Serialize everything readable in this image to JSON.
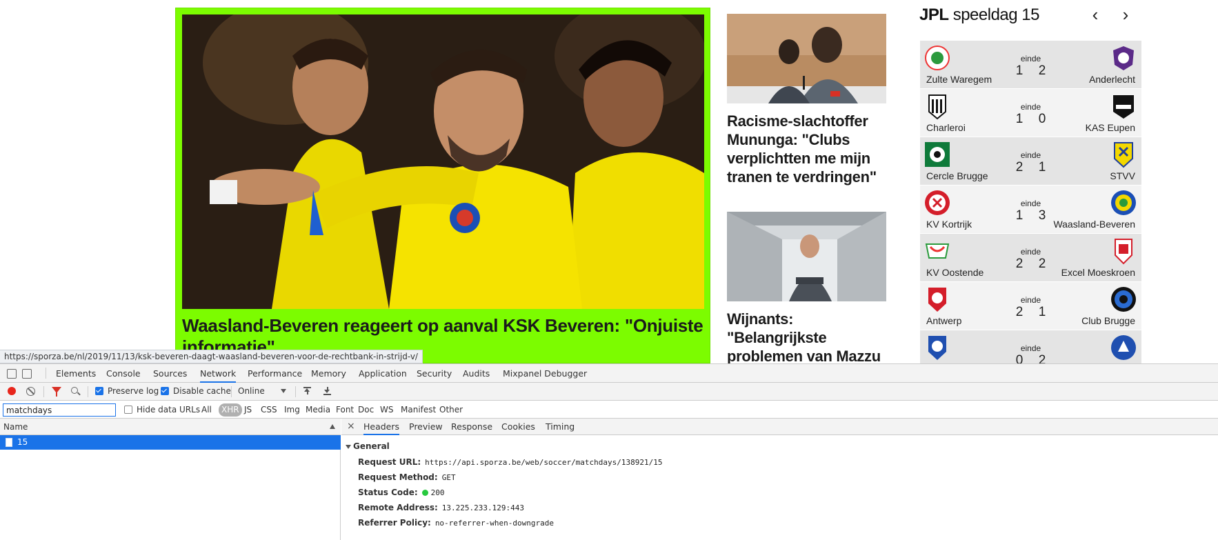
{
  "hero": {
    "title": "Waasland-Beveren reageert op aanval KSK Beveren: \"Onjuiste informatie\""
  },
  "articles": [
    {
      "title": "Racisme-slachtoffer Mununga: \"Clubs verplichtten me mijn tranen te verdringen\""
    },
    {
      "title": "Wijnants: \"Belangrijkste problemen van Mazzu"
    }
  ],
  "jpl": {
    "brand": "JPL",
    "matchday": "speeldag 15",
    "matches": [
      {
        "home": "Zulte Waregem",
        "away": "Anderlecht",
        "status": "einde",
        "home_score": "1",
        "away_score": "2"
      },
      {
        "home": "Charleroi",
        "away": "KAS Eupen",
        "status": "einde",
        "home_score": "1",
        "away_score": "0"
      },
      {
        "home": "Cercle Brugge",
        "away": "STVV",
        "status": "einde",
        "home_score": "2",
        "away_score": "1"
      },
      {
        "home": "KV Kortrijk",
        "away": "Waasland-Beveren",
        "status": "einde",
        "home_score": "1",
        "away_score": "3"
      },
      {
        "home": "KV Oostende",
        "away": "Excel Moeskroen",
        "status": "einde",
        "home_score": "2",
        "away_score": "2"
      },
      {
        "home": "Antwerp",
        "away": "Club Brugge",
        "status": "einde",
        "home_score": "2",
        "away_score": "1"
      },
      {
        "home": "",
        "away": "",
        "status": "einde",
        "home_score": "0",
        "away_score": "2"
      }
    ]
  },
  "status_url": "https://sporza.be/nl/2019/11/13/ksk-beveren-daagt-waasland-beveren-voor-de-rechtbank-in-strijd-v/",
  "devtools": {
    "tabs": [
      "Elements",
      "Console",
      "Sources",
      "Network",
      "Performance",
      "Memory",
      "Application",
      "Security",
      "Audits",
      "Mixpanel Debugger"
    ],
    "toolbar": {
      "preserve_log": "Preserve log",
      "disable_cache": "Disable cache",
      "throttle": "Online"
    },
    "filter": {
      "value": "matchdays",
      "hide_data_urls": "Hide data URLs",
      "types": [
        "All",
        "XHR",
        "JS",
        "CSS",
        "Img",
        "Media",
        "Font",
        "Doc",
        "WS",
        "Manifest",
        "Other"
      ],
      "active_type": "XHR"
    },
    "name_header": "Name",
    "request_name": "15",
    "detail_tabs": [
      "Headers",
      "Preview",
      "Response",
      "Cookies",
      "Timing"
    ],
    "close_glyph": "×",
    "general_label": "General",
    "headers": {
      "request_url_key": "Request URL:",
      "request_url": "https://api.sporza.be/web/soccer/matchdays/138921/15",
      "request_method_key": "Request Method:",
      "request_method": "GET",
      "status_code_key": "Status Code:",
      "status_code": "200",
      "remote_address_key": "Remote Address:",
      "remote_address": "13.225.233.129:443",
      "referrer_policy_key": "Referrer Policy:",
      "referrer_policy": "no-referrer-when-downgrade"
    }
  }
}
